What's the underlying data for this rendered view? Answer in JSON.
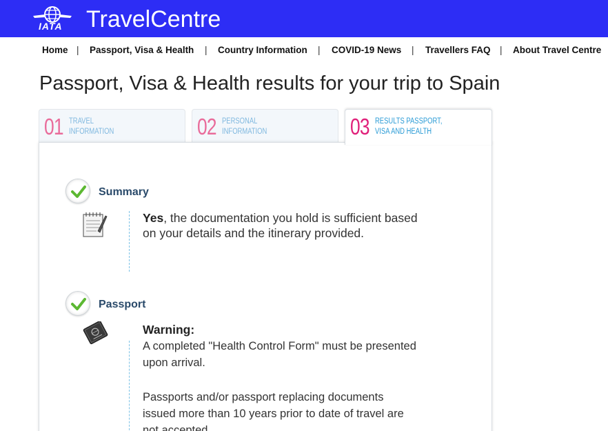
{
  "header": {
    "logo_text": "IATA",
    "brand": "TravelCentre",
    "bg_color": "#2d2df5"
  },
  "nav": {
    "items": [
      "Home",
      "Passport, Visa & Health",
      "Country Information",
      "COVID-19 News",
      "Travellers FAQ",
      "About Travel Centre"
    ],
    "separator": "|"
  },
  "page": {
    "title": "Passport, Visa & Health results for your trip to Spain"
  },
  "tabs": [
    {
      "num": "01",
      "line1": "TRAVEL",
      "line2": "INFORMATION",
      "active": false
    },
    {
      "num": "02",
      "line1": "PERSONAL",
      "line2": "INFORMATION",
      "active": false
    },
    {
      "num": "03",
      "line1": "RESULTS PASSPORT,",
      "line2": "VISA AND HEALTH",
      "active": true
    }
  ],
  "summary": {
    "title": "Summary",
    "icon": "notepad-icon",
    "answer": "Yes",
    "text": ", the documentation you hold is sufficient based on your details and the itinerary provided."
  },
  "passport": {
    "title": "Passport",
    "icon": "passport-icon",
    "warning_label": "Warning:",
    "warning_text": "A completed \"Health Control Form\" must be presented upon arrival.",
    "note": "Passports and/or passport replacing documents issued more than 10 years prior to date of travel are not accepted."
  },
  "colors": {
    "check_green": "#5cb832",
    "tab_number_inactive": "#e96b9a",
    "tab_label_inactive": "#7fb8df",
    "section_title": "#2a4a6a"
  }
}
